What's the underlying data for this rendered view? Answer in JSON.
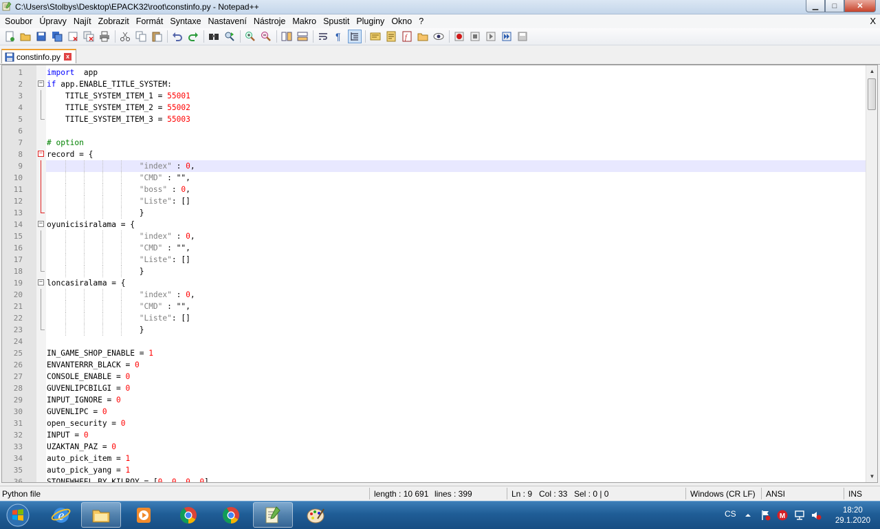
{
  "window": {
    "title": "C:\\Users\\Stolbys\\Desktop\\EPACK32\\root\\constinfo.py - Notepad++",
    "minimize": "▁",
    "maximize": "□",
    "close": "✕"
  },
  "menu": {
    "items": [
      "Soubor",
      "Úpravy",
      "Najít",
      "Zobrazit",
      "Formát",
      "Syntaxe",
      "Nastavení",
      "Nástroje",
      "Makro",
      "Spustit",
      "Pluginy",
      "Okno",
      "?"
    ],
    "close": "X"
  },
  "toolbar": {
    "icons": [
      "new-file-icon",
      "open-file-icon",
      "save-icon",
      "save-all-icon",
      "close-icon",
      "close-all-icon",
      "print-icon",
      "cut-icon",
      "copy-icon",
      "paste-icon",
      "undo-icon",
      "redo-icon",
      "find-icon",
      "replace-icon",
      "zoom-in-icon",
      "zoom-out-icon",
      "sync-vertical-icon",
      "sync-horizontal-icon",
      "word-wrap-icon",
      "show-all-chars-icon",
      "indent-guide-icon",
      "user-language-icon",
      "doc-map-icon",
      "function-list-icon",
      "folder-workspace-icon",
      "monitor-icon",
      "record-macro-icon",
      "stop-record-icon",
      "play-macro-icon",
      "run-macro-multiple-icon",
      "save-macro-icon"
    ]
  },
  "tab": {
    "label": "constinfo.py",
    "close": "x"
  },
  "editor": {
    "lines": [
      {
        "n": "1",
        "parts": [
          [
            "kw",
            "import"
          ],
          [
            "",
            "  app"
          ]
        ]
      },
      {
        "n": "2",
        "fold": "open",
        "parts": [
          [
            "kw",
            "if"
          ],
          [
            "",
            " app.ENABLE_TITLE_SYSTEM:"
          ]
        ]
      },
      {
        "n": "3",
        "guide": "line",
        "parts": [
          [
            "",
            "    TITLE_SYSTEM_ITEM_1 = "
          ],
          [
            "num",
            "55001"
          ]
        ]
      },
      {
        "n": "4",
        "guide": "line",
        "parts": [
          [
            "",
            "    TITLE_SYSTEM_ITEM_2 = "
          ],
          [
            "num",
            "55002"
          ]
        ]
      },
      {
        "n": "5",
        "guide": "end",
        "parts": [
          [
            "",
            "    TITLE_SYSTEM_ITEM_3 = "
          ],
          [
            "num",
            "55003"
          ]
        ]
      },
      {
        "n": "6",
        "parts": []
      },
      {
        "n": "7",
        "parts": [
          [
            "cmt",
            "# option"
          ]
        ]
      },
      {
        "n": "8",
        "fold": "red",
        "parts": [
          [
            "",
            "record = {"
          ]
        ]
      },
      {
        "n": "9",
        "guide": "redline",
        "current": true,
        "parts": [
          [
            "",
            "                    "
          ],
          [
            "str",
            "\"index\""
          ],
          [
            "",
            " : "
          ],
          [
            "num",
            "0"
          ],
          [
            "",
            ","
          ]
        ]
      },
      {
        "n": "10",
        "guide": "redline",
        "parts": [
          [
            "",
            "                    "
          ],
          [
            "str",
            "\"CMD\""
          ],
          [
            "",
            " : \"\","
          ]
        ]
      },
      {
        "n": "11",
        "guide": "redline",
        "parts": [
          [
            "",
            "                    "
          ],
          [
            "str",
            "\"boss\""
          ],
          [
            "",
            " : "
          ],
          [
            "num",
            "0"
          ],
          [
            "",
            ","
          ]
        ]
      },
      {
        "n": "12",
        "guide": "redline",
        "parts": [
          [
            "",
            "                    "
          ],
          [
            "str",
            "\"Liste\""
          ],
          [
            "",
            ": []"
          ]
        ]
      },
      {
        "n": "13",
        "guide": "redend",
        "parts": [
          [
            "",
            "                    }"
          ]
        ]
      },
      {
        "n": "14",
        "fold": "open",
        "parts": [
          [
            "",
            "oyunicisiralama = {"
          ]
        ]
      },
      {
        "n": "15",
        "guide": "line",
        "parts": [
          [
            "",
            "                    "
          ],
          [
            "str",
            "\"index\""
          ],
          [
            "",
            " : "
          ],
          [
            "num",
            "0"
          ],
          [
            "",
            ","
          ]
        ]
      },
      {
        "n": "16",
        "guide": "line",
        "parts": [
          [
            "",
            "                    "
          ],
          [
            "str",
            "\"CMD\""
          ],
          [
            "",
            " : \"\","
          ]
        ]
      },
      {
        "n": "17",
        "guide": "line",
        "parts": [
          [
            "",
            "                    "
          ],
          [
            "str",
            "\"Liste\""
          ],
          [
            "",
            ": []"
          ]
        ]
      },
      {
        "n": "18",
        "guide": "end",
        "parts": [
          [
            "",
            "                    }"
          ]
        ]
      },
      {
        "n": "19",
        "fold": "open",
        "parts": [
          [
            "",
            "loncasiralama = {"
          ]
        ]
      },
      {
        "n": "20",
        "guide": "line",
        "parts": [
          [
            "",
            "                    "
          ],
          [
            "str",
            "\"index\""
          ],
          [
            "",
            " : "
          ],
          [
            "num",
            "0"
          ],
          [
            "",
            ","
          ]
        ]
      },
      {
        "n": "21",
        "guide": "line",
        "parts": [
          [
            "",
            "                    "
          ],
          [
            "str",
            "\"CMD\""
          ],
          [
            "",
            " : \"\","
          ]
        ]
      },
      {
        "n": "22",
        "guide": "line",
        "parts": [
          [
            "",
            "                    "
          ],
          [
            "str",
            "\"Liste\""
          ],
          [
            "",
            ": []"
          ]
        ]
      },
      {
        "n": "23",
        "guide": "end",
        "parts": [
          [
            "",
            "                    }"
          ]
        ]
      },
      {
        "n": "24",
        "parts": []
      },
      {
        "n": "25",
        "parts": [
          [
            "",
            "IN_GAME_SHOP_ENABLE = "
          ],
          [
            "num",
            "1"
          ]
        ]
      },
      {
        "n": "26",
        "parts": [
          [
            "",
            "ENVANTERRR_BLACK = "
          ],
          [
            "num",
            "0"
          ]
        ]
      },
      {
        "n": "27",
        "parts": [
          [
            "",
            "CONSOLE_ENABLE = "
          ],
          [
            "num",
            "0"
          ]
        ]
      },
      {
        "n": "28",
        "parts": [
          [
            "",
            "GUVENLIPCBILGI = "
          ],
          [
            "num",
            "0"
          ]
        ]
      },
      {
        "n": "29",
        "parts": [
          [
            "",
            "INPUT_IGNORE = "
          ],
          [
            "num",
            "0"
          ]
        ]
      },
      {
        "n": "30",
        "parts": [
          [
            "",
            "GUVENLIPC = "
          ],
          [
            "num",
            "0"
          ]
        ]
      },
      {
        "n": "31",
        "parts": [
          [
            "",
            "open_security = "
          ],
          [
            "num",
            "0"
          ]
        ]
      },
      {
        "n": "32",
        "parts": [
          [
            "",
            "INPUT = "
          ],
          [
            "num",
            "0"
          ]
        ]
      },
      {
        "n": "33",
        "parts": [
          [
            "",
            "UZAKTAN_PAZ = "
          ],
          [
            "num",
            "0"
          ]
        ]
      },
      {
        "n": "34",
        "parts": [
          [
            "",
            "auto_pick_item = "
          ],
          [
            "num",
            "1"
          ]
        ]
      },
      {
        "n": "35",
        "parts": [
          [
            "",
            "auto_pick_yang = "
          ],
          [
            "num",
            "1"
          ]
        ]
      },
      {
        "n": "36",
        "parts": [
          [
            "",
            "STONEWHEEL_BY_KILROY = ["
          ],
          [
            "num",
            "0"
          ],
          [
            "",
            ", "
          ],
          [
            "num",
            "0"
          ],
          [
            "",
            ", "
          ],
          [
            "num",
            "0"
          ],
          [
            "",
            ", "
          ],
          [
            "num",
            "0"
          ],
          [
            "",
            "]"
          ]
        ]
      }
    ]
  },
  "status": {
    "lang": "Python file",
    "length": "length : 10 691",
    "lines": "lines : 399",
    "ln": "Ln : 9",
    "col": "Col : 33",
    "sel": "Sel : 0 | 0",
    "eol": "Windows (CR LF)",
    "encoding": "ANSI",
    "mode": "INS"
  },
  "taskbar": {
    "apps": [
      "internet-explorer-icon",
      "file-explorer-icon",
      "media-player-icon",
      "chrome-icon",
      "chrome-icon",
      "notepadpp-icon",
      "paint-icon"
    ],
    "language": "CS",
    "time": "18:20",
    "date": "29.1.2020"
  }
}
